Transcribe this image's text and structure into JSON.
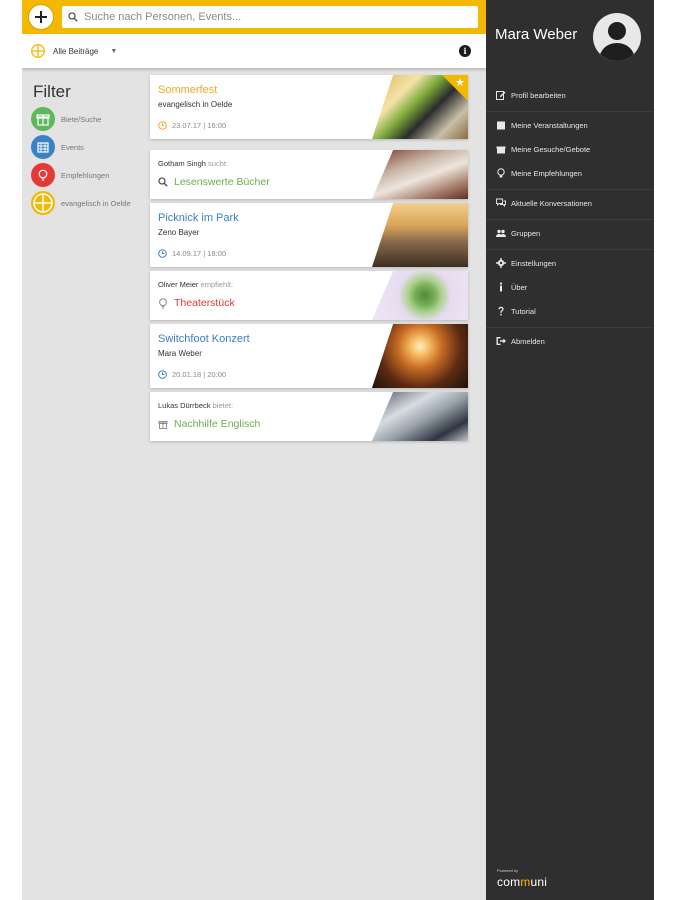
{
  "topbar": {
    "search_placeholder": "Suche nach Personen, Events..."
  },
  "subbar": {
    "filter_label": "Alle Beiträge",
    "caret": "▼"
  },
  "filters": {
    "title": "Filter",
    "items": [
      {
        "label": "Biete/Suche",
        "color": "#5cb85c",
        "icon": "gift-icon"
      },
      {
        "label": "Events",
        "color": "#3b82c4",
        "icon": "calendar-icon"
      },
      {
        "label": "Empfehlungen",
        "color": "#e53935",
        "icon": "lightbulb-icon"
      },
      {
        "label": "evangelisch in Oelde",
        "color": "#f5b800",
        "icon": "cross-icon"
      }
    ]
  },
  "feed": {
    "cards": [
      {
        "kind": "event",
        "title": "Sommerfest",
        "title_color": "#f5a623",
        "subtitle": "evangelisch in Oelde",
        "meta": "23.07.17 | 16:00",
        "meta_color": "#f5a623",
        "starred": true,
        "star_glyph": "★"
      },
      {
        "kind": "offer",
        "person": "Gotham Singh",
        "verb": "sucht:",
        "text": "Lesenswerte Bücher",
        "text_color": "#6ab04c",
        "icon": "search-icon"
      },
      {
        "kind": "event",
        "title": "Picknick im Park",
        "title_color": "#3b7fc4",
        "subtitle": "Zeno Bayer",
        "meta": "14.09.17 | 18:00",
        "meta_color": "#3b7fc4"
      },
      {
        "kind": "offer",
        "person": "Oliver Meier",
        "verb": "empfiehlt:",
        "text": "Theaterstück",
        "text_color": "#e53935",
        "icon": "lightbulb-icon"
      },
      {
        "kind": "event",
        "title": "Switchfoot Konzert",
        "title_color": "#3b7fc4",
        "subtitle": "Mara Weber",
        "meta": "20.01.18 | 20:00",
        "meta_color": "#3b7fc4"
      },
      {
        "kind": "offer",
        "person": "Lukas Dürrbeck",
        "verb": "bietet:",
        "text": "Nachhilfe Englisch",
        "text_color": "#6ab04c",
        "icon": "gift-icon"
      }
    ]
  },
  "drawer": {
    "user_name": "Mara Weber",
    "menu": [
      {
        "label": "Profil bearbeiten",
        "icon": "edit-icon"
      },
      {
        "label": "Meine Veranstaltungen",
        "icon": "calendar-icon"
      },
      {
        "label": "Meine Gesuche/Gebote",
        "icon": "gift-icon"
      },
      {
        "label": "Meine Empfehlungen",
        "icon": "lightbulb-icon"
      },
      {
        "label": "Aktuelle Konversationen",
        "icon": "chat-icon"
      },
      {
        "label": "Gruppen",
        "icon": "group-icon"
      },
      {
        "label": "Einstellungen",
        "icon": "gear-icon"
      },
      {
        "label": "Über",
        "icon": "info-icon"
      },
      {
        "label": "Tutorial",
        "icon": "question-icon"
      },
      {
        "label": "Abmelden",
        "icon": "logout-icon"
      }
    ],
    "powered_by": "Powered by",
    "brand_left": "com",
    "brand_m": "m",
    "brand_right": "uni"
  },
  "colors": {
    "accent": "#f5b800",
    "drawer_bg": "#2f2f2f",
    "main_bg": "#e3e3e3"
  }
}
